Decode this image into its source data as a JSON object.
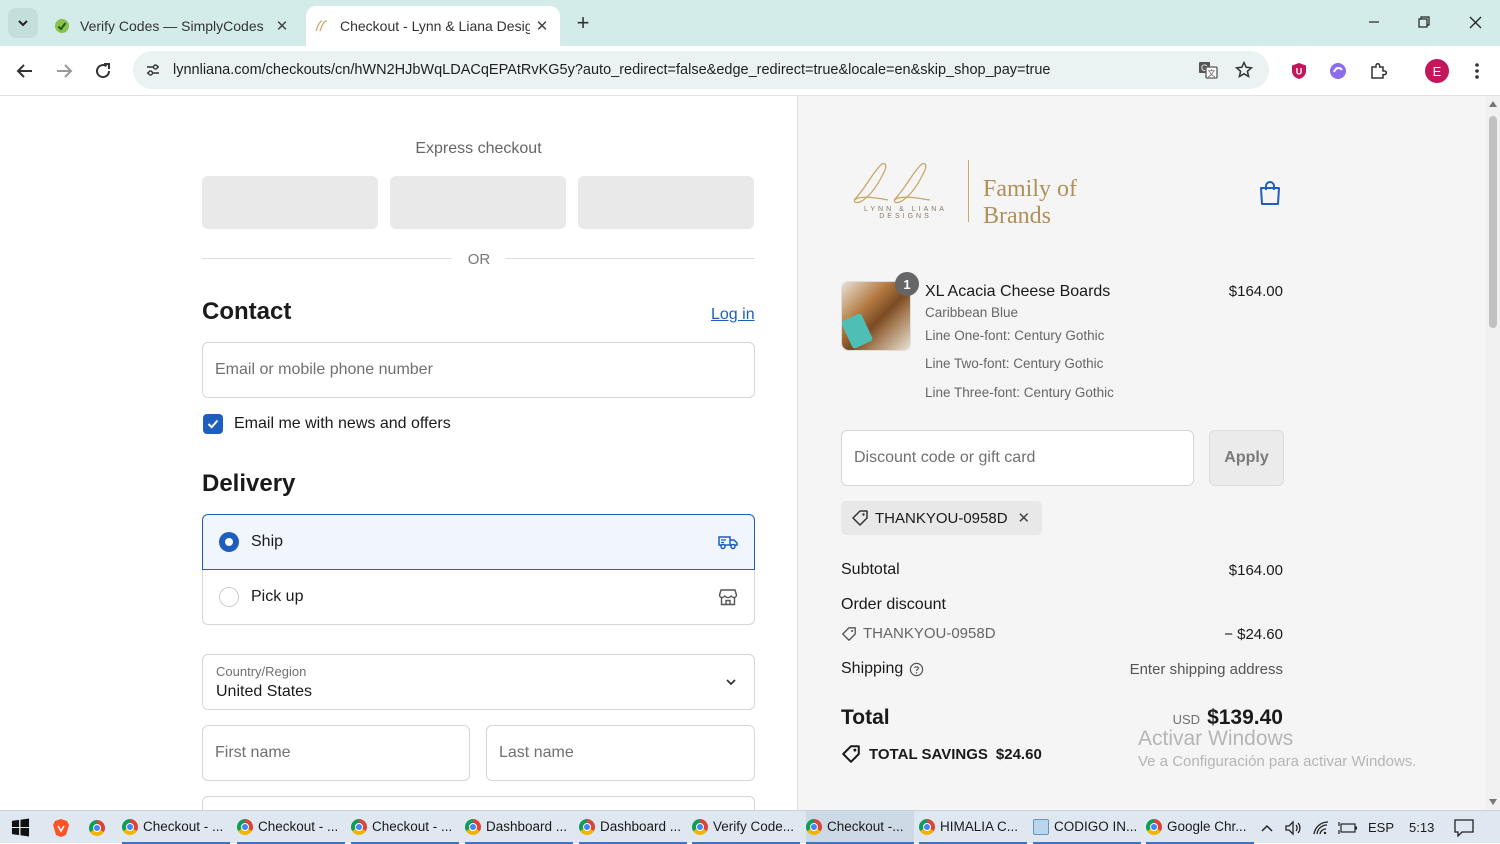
{
  "browser": {
    "tabs": [
      {
        "title": "Verify Codes — SimplyCodes",
        "active": false
      },
      {
        "title": "Checkout - Lynn & Liana Designs",
        "active": true
      }
    ],
    "url": "lynnliana.com/checkouts/cn/hWN2HJbWqLDACqEPAtRvKG5y?auto_redirect=false&edge_redirect=true&locale=en&skip_shop_pay=true",
    "profile_initial": "E"
  },
  "checkout": {
    "express_label": "Express checkout",
    "or_label": "OR",
    "contact": {
      "heading": "Contact",
      "login_label": "Log in",
      "email_placeholder": "Email or mobile phone number",
      "newsletter_label": "Email me with news and offers",
      "newsletter_checked": true
    },
    "delivery": {
      "heading": "Delivery",
      "options": [
        {
          "label": "Ship",
          "selected": true,
          "icon": "truck-icon"
        },
        {
          "label": "Pick up",
          "selected": false,
          "icon": "store-icon"
        }
      ],
      "country_label": "Country/Region",
      "country_value": "United States",
      "first_name_placeholder": "First name",
      "last_name_placeholder": "Last name"
    }
  },
  "summary": {
    "brand_sub": "LYNN & LIANA DESIGNS",
    "brand_text": "Family of Brands",
    "item": {
      "quantity": "1",
      "name": "XL Acacia Cheese Boards",
      "price": "$164.00",
      "meta": [
        "Caribbean Blue",
        "Line One-font: Century Gothic",
        "Line Two-font: Century Gothic",
        "Line Three-font: Century Gothic"
      ]
    },
    "discount_placeholder": "Discount code or gift card",
    "apply_label": "Apply",
    "applied_code": "THANKYOU-0958D",
    "subtotal_label": "Subtotal",
    "subtotal_value": "$164.00",
    "order_discount_label": "Order discount",
    "discount_code": "THANKYOU-0958D",
    "discount_value": "− $24.60",
    "shipping_label": "Shipping",
    "shipping_value": "Enter shipping address",
    "total_label": "Total",
    "total_currency": "USD",
    "total_value": "$139.40",
    "savings_label": "TOTAL SAVINGS",
    "savings_value": "$24.60"
  },
  "watermark": {
    "line1": "Activar Windows",
    "line2": "Ve a Configuración para activar Windows."
  },
  "taskbar": {
    "items": [
      {
        "label": "Checkout - ...",
        "icon": "chrome-icon"
      },
      {
        "label": "Checkout - ...",
        "icon": "chrome-icon"
      },
      {
        "label": "Checkout - ...",
        "icon": "chrome-icon"
      },
      {
        "label": "Dashboard ...",
        "icon": "chrome-icon"
      },
      {
        "label": "Dashboard ...",
        "icon": "chrome-icon"
      },
      {
        "label": "Verify Code...",
        "icon": "chrome-icon"
      },
      {
        "label": "Checkout -...",
        "icon": "chrome-icon"
      },
      {
        "label": "HIMALIA C...",
        "icon": "chrome-icon"
      },
      {
        "label": "CODIGO IN...",
        "icon": "notepad-icon"
      },
      {
        "label": "Google Chr...",
        "icon": "chrome-icon"
      }
    ],
    "language": "ESP",
    "time": "5:13"
  }
}
